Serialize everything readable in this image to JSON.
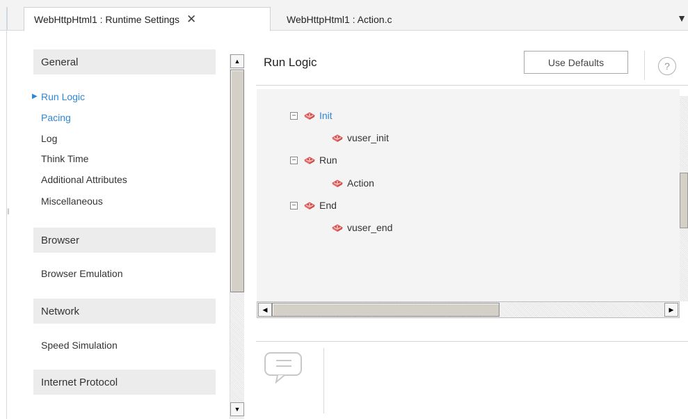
{
  "tabs": [
    {
      "label": "WebHttpHtml1 : Runtime Settings",
      "active": true
    },
    {
      "label": "WebHttpHtml1 : Action.c",
      "active": false
    }
  ],
  "tab_close_glyph": "✕",
  "tab_menu_glyph": "▼",
  "nav": {
    "sections": [
      {
        "title": "General",
        "items": [
          "Run Logic",
          "Pacing",
          "Log",
          "Think Time",
          "Additional Attributes",
          "Miscellaneous"
        ]
      },
      {
        "title": "Browser",
        "items": [
          "Browser Emulation"
        ]
      },
      {
        "title": "Network",
        "items": [
          "Speed Simulation"
        ]
      },
      {
        "title": "Internet Protocol",
        "items": []
      }
    ],
    "selected_item": "Run Logic",
    "selected_marker": "▶"
  },
  "main": {
    "title": "Run Logic",
    "use_defaults_label": "Use Defaults",
    "help_glyph": "?"
  },
  "tree": [
    {
      "label": "Init",
      "expander": "−",
      "highlighted": true,
      "children": [
        {
          "label": "vuser_init"
        }
      ]
    },
    {
      "label": "Run",
      "expander": "−",
      "highlighted": false,
      "children": [
        {
          "label": "Action"
        }
      ]
    },
    {
      "label": "End",
      "expander": "−",
      "highlighted": false,
      "children": [
        {
          "label": "vuser_end"
        }
      ]
    }
  ],
  "icons": {
    "tree_node": "brick-icon",
    "comment": "comment-icon",
    "help": "help-icon"
  },
  "colors": {
    "link": "#2e86d8",
    "brick": "#e07070"
  }
}
